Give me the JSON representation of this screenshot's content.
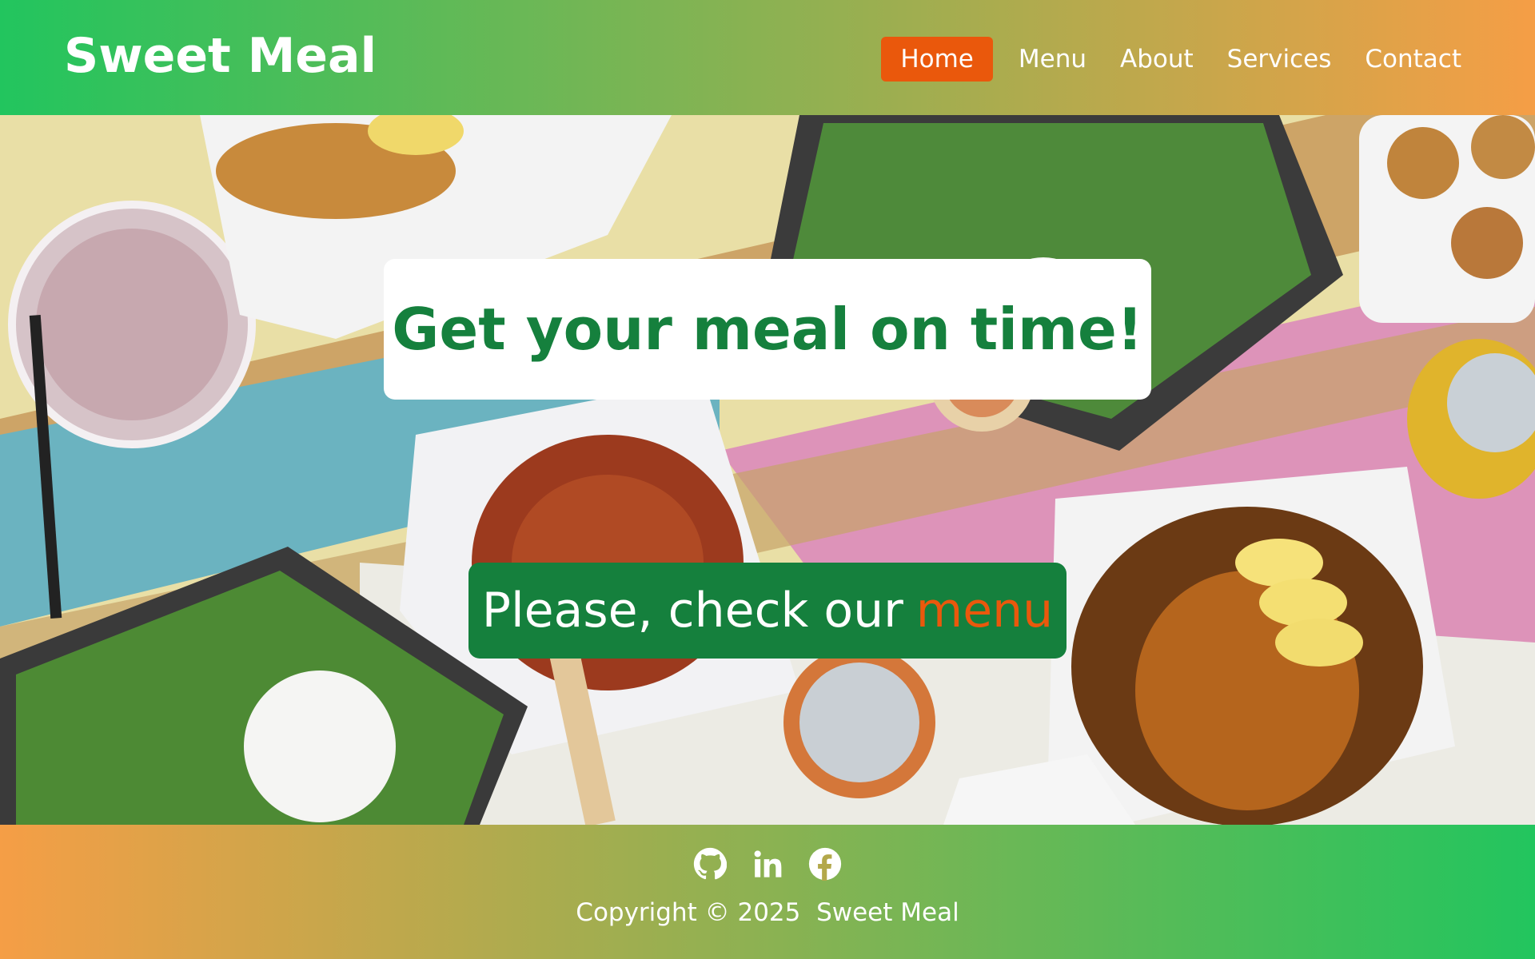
{
  "header": {
    "brand": "Sweet Meal",
    "nav": [
      {
        "label": "Home",
        "active": true
      },
      {
        "label": "Menu",
        "active": false
      },
      {
        "label": "About",
        "active": false
      },
      {
        "label": "Services",
        "active": false
      },
      {
        "label": "Contact",
        "active": false
      }
    ]
  },
  "hero": {
    "title": "Get your meal on time!",
    "cta_prefix": "Please, check our",
    "cta_link": "menu"
  },
  "footer": {
    "socials": [
      "github-icon",
      "linkedin-icon",
      "facebook-icon"
    ],
    "copyright": "Copyright © 2025  Sweet Meal"
  },
  "colors": {
    "accent_orange": "#ea580c",
    "brand_green": "#15803d",
    "gradient_green": "#22c55e",
    "gradient_orange": "#f59e46"
  }
}
